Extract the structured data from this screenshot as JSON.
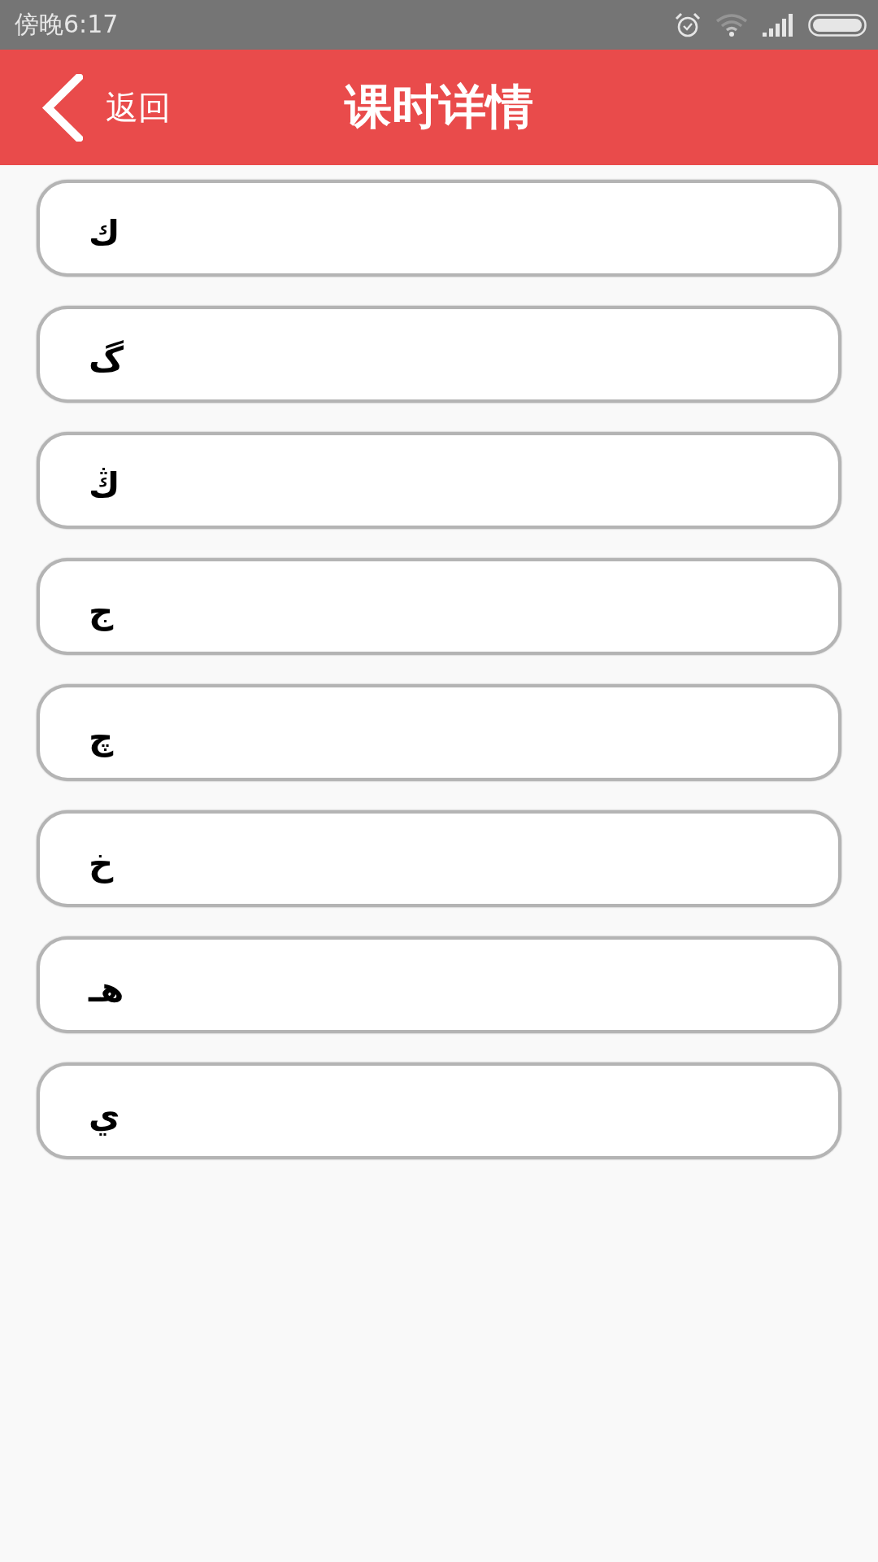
{
  "status_bar": {
    "time": "傍晚6:17"
  },
  "header": {
    "back_label": "返回",
    "title": "课时详情"
  },
  "items": [
    {
      "label": "ك"
    },
    {
      "label": "گ"
    },
    {
      "label": "ڭ"
    },
    {
      "label": "ج"
    },
    {
      "label": "چ"
    },
    {
      "label": "خ"
    },
    {
      "label": "هـ"
    },
    {
      "label": "ي"
    }
  ]
}
